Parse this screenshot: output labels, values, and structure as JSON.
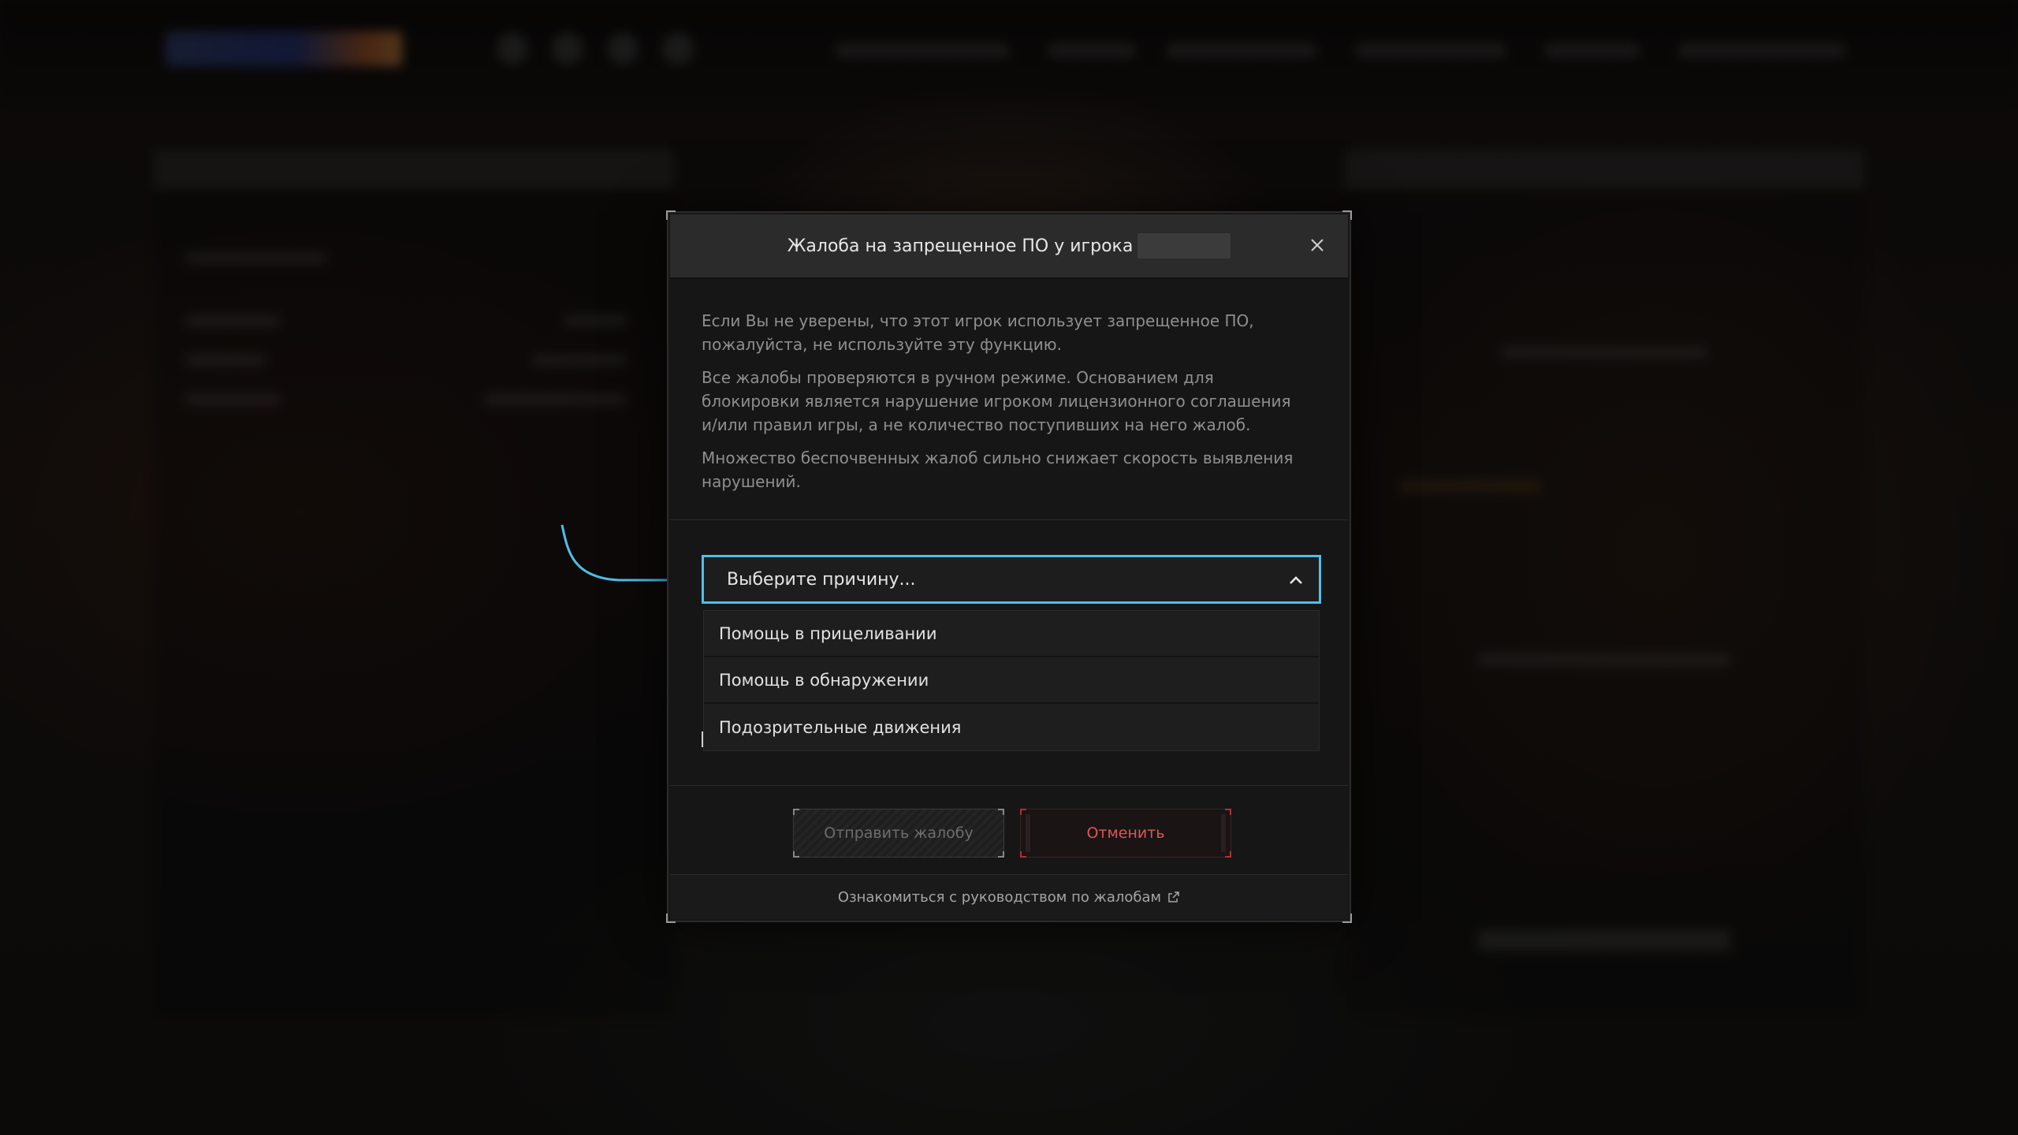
{
  "modal": {
    "title": "Жалоба на запрещенное ПО у игрока",
    "paragraphs": [
      "Если Вы не уверены, что этот игрок использует запрещенное ПО, пожалуйста, не используйте эту функцию.",
      "Все жалобы проверяются в ручном режиме. Основанием для блокировки является нарушение игроком лицензионного соглашения и/или правил игры, а не количество поступивших на него жалоб.",
      "Множество беспочвенных жалоб сильно снижает скорость выявления нарушений."
    ],
    "select": {
      "placeholder": "Выберите причину...",
      "options": [
        "Помощь в прицеливании",
        "Помощь в обнаружении",
        "Подозрительные движения"
      ]
    },
    "buttons": {
      "submit": "Отправить жалобу",
      "cancel": "Отменить"
    },
    "footer_link": "Ознакомиться с руководством по жалобам"
  },
  "icons": {
    "close": "close-icon",
    "chevron": "chevron-up-icon",
    "external": "external-link-icon"
  },
  "colors": {
    "accent": "#4cc0ea",
    "cancel": "#e05555"
  }
}
